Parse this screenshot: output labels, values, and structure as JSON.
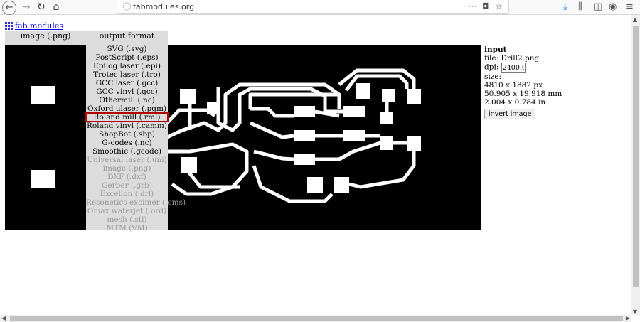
{
  "browser": {
    "url": "fabmodules.org",
    "icons": {
      "back": "arrow-left-icon",
      "forward": "arrow-right-icon",
      "reload": "reload-icon",
      "home": "home-icon",
      "info": "info-icon",
      "more": "more-icon",
      "pocket": "pocket-icon",
      "bookmark": "star-icon",
      "download": "download-icon",
      "library": "library-icon",
      "sidebar": "sidebar-icon",
      "account": "account-icon",
      "menu": "hamburger-icon"
    }
  },
  "page": {
    "link_text": "fab modules",
    "input_header": "image (.png)",
    "output_header": "output format",
    "output_formats": [
      {
        "label": "SVG (.svg)",
        "enabled": true
      },
      {
        "label": "PostScript (.eps)",
        "enabled": true
      },
      {
        "label": "Epilog laser (.epi)",
        "enabled": true
      },
      {
        "label": "Trotec laser (.tro)",
        "enabled": true
      },
      {
        "label": "GCC laser (.gcc)",
        "enabled": true
      },
      {
        "label": "GCC vinyl (.gcc)",
        "enabled": true
      },
      {
        "label": "Othermill (.nc)",
        "enabled": true
      },
      {
        "label": "Oxford ulaser (.pgm)",
        "enabled": true
      },
      {
        "label": "Roland mill (.rml)",
        "enabled": true,
        "selected": true
      },
      {
        "label": "Roland vinyl (.camm)",
        "enabled": true
      },
      {
        "label": "ShopBot (.sbp)",
        "enabled": true
      },
      {
        "label": "G-codes (.nc)",
        "enabled": true
      },
      {
        "label": "Smoothie (.gcode)",
        "enabled": true
      },
      {
        "label": "Universal laser (.uni)",
        "enabled": false
      },
      {
        "label": "image (.png)",
        "enabled": false
      },
      {
        "label": "DXF (.dxf)",
        "enabled": false
      },
      {
        "label": "Gerber (.grb)",
        "enabled": false
      },
      {
        "label": "Excellon (.drl)",
        "enabled": false
      },
      {
        "label": "Resonetics excimer (.oms)",
        "enabled": false
      },
      {
        "label": "Omax waterjet (.ord)",
        "enabled": false
      },
      {
        "label": "mesh (.stl)",
        "enabled": false
      },
      {
        "label": "MTM (VM)",
        "enabled": false
      }
    ],
    "input_panel": {
      "title": "input",
      "file": "file: Drill2.png",
      "dpi_label": "dpi:",
      "dpi_value": "2400.0",
      "size_label": "size:",
      "size_px": "4810 x 1882 px",
      "size_mm": "50.905 x 19.918 mm",
      "size_in": "2.004 x 0.784 in",
      "invert_label": "invert image"
    }
  }
}
